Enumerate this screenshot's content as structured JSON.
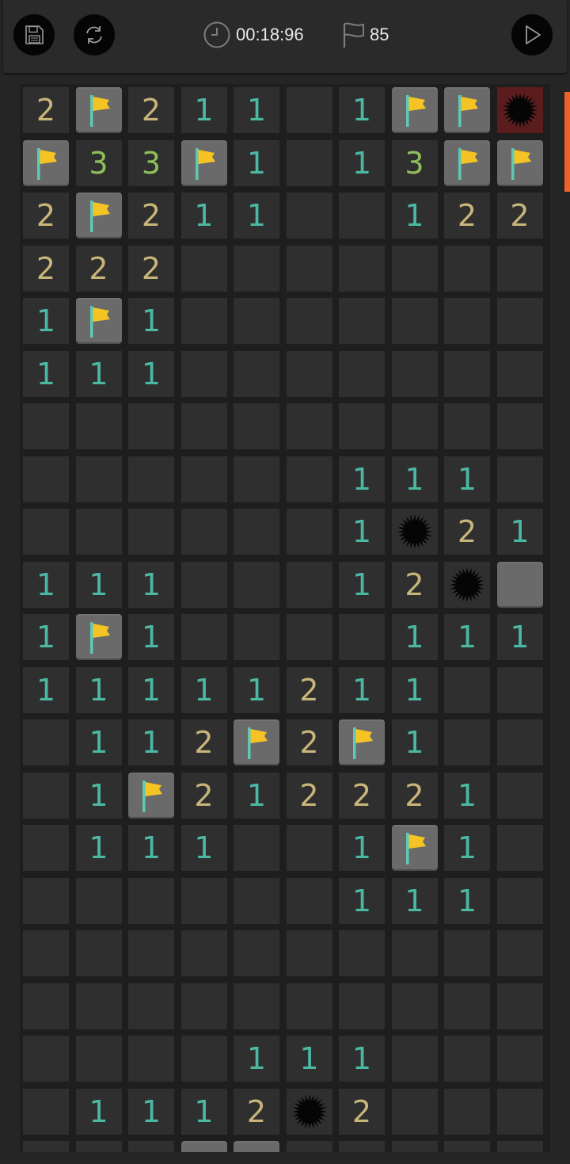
{
  "toolbar": {
    "save_icon": "floppy-disk-icon",
    "restart_icon": "refresh-icon",
    "play_icon": "play-icon",
    "timer_icon": "clock-icon",
    "flag_icon": "flag-outline-icon",
    "timer": "00:18:96",
    "flags_remaining": "85"
  },
  "colors": {
    "one": "#4bb8a4",
    "two": "#c8b57a",
    "three": "#8fbf5a",
    "open": "#2f2f2f",
    "closed": "#6a6a6a",
    "exploded": "#5a1c1c",
    "flag": "#f6c324",
    "flag_pole": "#5fc9b4",
    "accent": "#ee6325"
  },
  "board": {
    "columns": 10,
    "legend": "F = flag, M = mine, X = exploded mine, C = unopened, . = open empty",
    "rows": [
      [
        "2",
        "F",
        "2",
        "1",
        "1",
        ".",
        "1",
        "F",
        "F",
        "X"
      ],
      [
        "F",
        "3",
        "3",
        "F",
        "1",
        ".",
        "1",
        "3",
        "F",
        "F"
      ],
      [
        "2",
        "F",
        "2",
        "1",
        "1",
        ".",
        ".",
        "1",
        "2",
        "2"
      ],
      [
        "2",
        "2",
        "2",
        ".",
        ".",
        ".",
        ".",
        ".",
        ".",
        "."
      ],
      [
        "1",
        "F",
        "1",
        ".",
        ".",
        ".",
        ".",
        ".",
        ".",
        "."
      ],
      [
        "1",
        "1",
        "1",
        ".",
        ".",
        ".",
        ".",
        ".",
        ".",
        "."
      ],
      [
        ".",
        ".",
        ".",
        ".",
        ".",
        ".",
        ".",
        ".",
        ".",
        "."
      ],
      [
        ".",
        ".",
        ".",
        ".",
        ".",
        ".",
        "1",
        "1",
        "1",
        "."
      ],
      [
        ".",
        ".",
        ".",
        ".",
        ".",
        ".",
        "1",
        "M",
        "2",
        "1"
      ],
      [
        "1",
        "1",
        "1",
        ".",
        ".",
        ".",
        "1",
        "2",
        "M",
        "C"
      ],
      [
        "1",
        "F",
        "1",
        ".",
        ".",
        ".",
        ".",
        "1",
        "1",
        "1"
      ],
      [
        "1",
        "1",
        "1",
        "1",
        "1",
        "2",
        "1",
        "1",
        ".",
        "."
      ],
      [
        ".",
        "1",
        "1",
        "2",
        "F",
        "2",
        "F",
        "1",
        ".",
        "."
      ],
      [
        ".",
        "1",
        "F",
        "2",
        "1",
        "2",
        "2",
        "2",
        "1",
        "."
      ],
      [
        ".",
        "1",
        "1",
        "1",
        ".",
        ".",
        "1",
        "F",
        "1",
        "."
      ],
      [
        ".",
        ".",
        ".",
        ".",
        ".",
        ".",
        "1",
        "1",
        "1",
        "."
      ],
      [
        ".",
        ".",
        ".",
        ".",
        ".",
        ".",
        ".",
        ".",
        ".",
        "."
      ],
      [
        ".",
        ".",
        ".",
        ".",
        ".",
        ".",
        ".",
        ".",
        ".",
        "."
      ],
      [
        ".",
        ".",
        ".",
        ".",
        "1",
        "1",
        "1",
        ".",
        ".",
        "."
      ],
      [
        ".",
        "1",
        "1",
        "1",
        "2",
        "M",
        "2",
        ".",
        ".",
        "."
      ],
      [
        ".",
        ".",
        ".",
        "C",
        "C",
        ".",
        ".",
        ".",
        ".",
        "."
      ]
    ]
  }
}
